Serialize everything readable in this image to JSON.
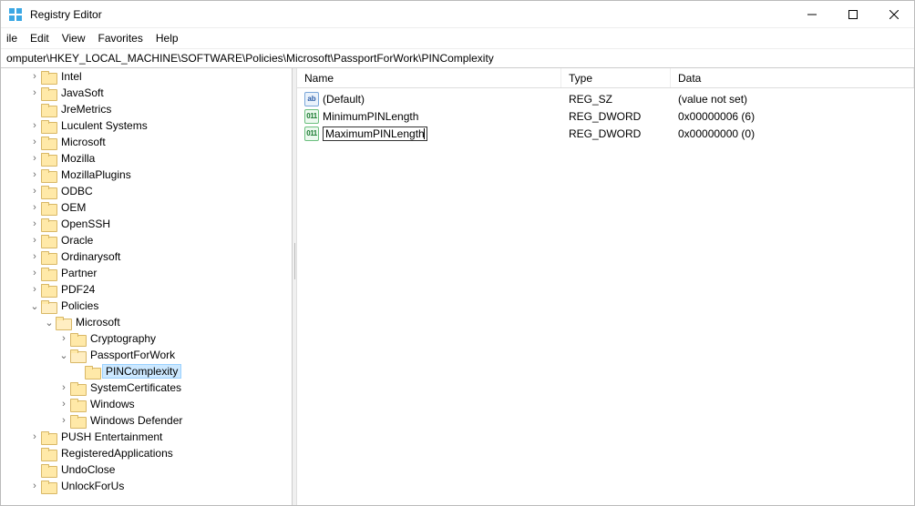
{
  "window": {
    "title": "Registry Editor"
  },
  "menu": {
    "file": "ile",
    "edit": "Edit",
    "view": "View",
    "favorites": "Favorites",
    "help": "Help"
  },
  "address": {
    "path": "omputer\\HKEY_LOCAL_MACHINE\\SOFTWARE\\Policies\\Microsoft\\PassportForWork\\PINComplexity"
  },
  "columns": {
    "name": "Name",
    "type": "Type",
    "data": "Data"
  },
  "values": [
    {
      "icon": "str",
      "name": "(Default)",
      "type": "REG_SZ",
      "data": "(value not set)",
      "editing": false
    },
    {
      "icon": "bin",
      "name": "MinimumPINLength",
      "type": "REG_DWORD",
      "data": "0x00000006 (6)",
      "editing": false
    },
    {
      "icon": "bin",
      "name": "MaximumPINLength",
      "type": "REG_DWORD",
      "data": "0x00000000 (0)",
      "editing": true
    }
  ],
  "tree": {
    "nodes": [
      {
        "label": "Intel",
        "expandable": true,
        "expanded": false
      },
      {
        "label": "JavaSoft",
        "expandable": true,
        "expanded": false
      },
      {
        "label": "JreMetrics",
        "expandable": false,
        "expanded": false
      },
      {
        "label": "Luculent Systems",
        "expandable": true,
        "expanded": false
      },
      {
        "label": "Microsoft",
        "expandable": true,
        "expanded": false
      },
      {
        "label": "Mozilla",
        "expandable": true,
        "expanded": false
      },
      {
        "label": "MozillaPlugins",
        "expandable": true,
        "expanded": false
      },
      {
        "label": "ODBC",
        "expandable": true,
        "expanded": false
      },
      {
        "label": "OEM",
        "expandable": true,
        "expanded": false
      },
      {
        "label": "OpenSSH",
        "expandable": true,
        "expanded": false
      },
      {
        "label": "Oracle",
        "expandable": true,
        "expanded": false
      },
      {
        "label": "Ordinarysoft",
        "expandable": true,
        "expanded": false
      },
      {
        "label": "Partner",
        "expandable": true,
        "expanded": false
      },
      {
        "label": "PDF24",
        "expandable": true,
        "expanded": false
      }
    ],
    "policies": {
      "label": "Policies",
      "microsoft": {
        "label": "Microsoft",
        "children": [
          {
            "label": "Cryptography",
            "expandable": true,
            "expanded": false,
            "children": []
          },
          {
            "label": "PassportForWork",
            "expandable": true,
            "expanded": true,
            "children": [
              {
                "label": "PINComplexity",
                "expandable": false,
                "selected": true
              }
            ]
          },
          {
            "label": "SystemCertificates",
            "expandable": true,
            "expanded": false,
            "children": []
          },
          {
            "label": "Windows",
            "expandable": true,
            "expanded": false,
            "children": []
          },
          {
            "label": "Windows Defender",
            "expandable": true,
            "expanded": false,
            "children": []
          }
        ]
      }
    },
    "post_nodes": [
      {
        "label": "PUSH Entertainment",
        "expandable": true,
        "expanded": false
      },
      {
        "label": "RegisteredApplications",
        "expandable": false,
        "expanded": false
      },
      {
        "label": "UndoClose",
        "expandable": false,
        "expanded": false
      },
      {
        "label": "UnlockForUs",
        "expandable": true,
        "expanded": false
      }
    ]
  }
}
